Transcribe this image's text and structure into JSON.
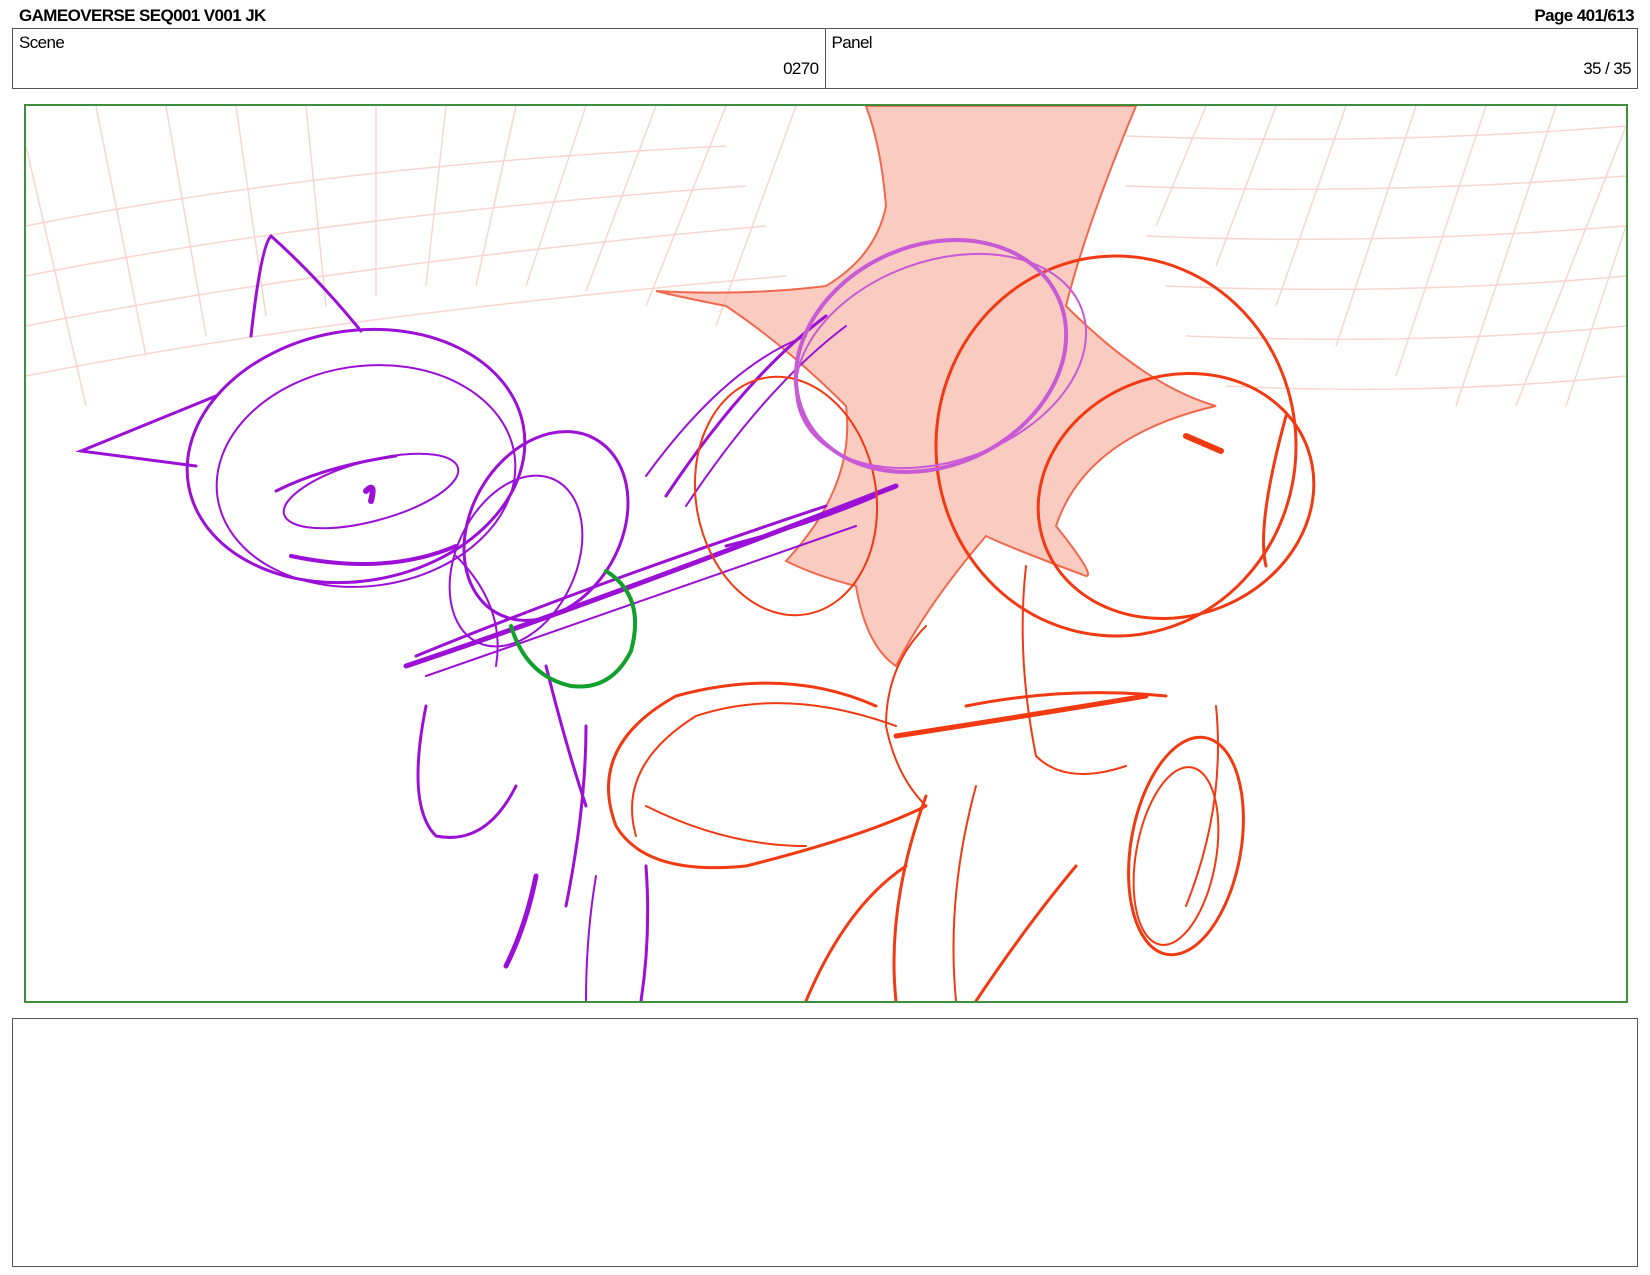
{
  "header": {
    "title": "GAMEOVERSE SEQ001 V001 JK",
    "page": "Page 401/613"
  },
  "info": {
    "scene_label": "Scene",
    "scene_value": "0270",
    "panel_label": "Panel",
    "panel_value": "35 / 35"
  },
  "sketch": {
    "colors": {
      "purple_character": "#9b0fd6",
      "red_character": "#f23a12",
      "impact_fill": "#f7b5a6",
      "impact_ring": "#c85ad6",
      "green_ring": "#12a02c",
      "grid": "#f6c8bf",
      "frame_border": "#3e8e3e"
    }
  },
  "notes": {
    "text": ""
  }
}
